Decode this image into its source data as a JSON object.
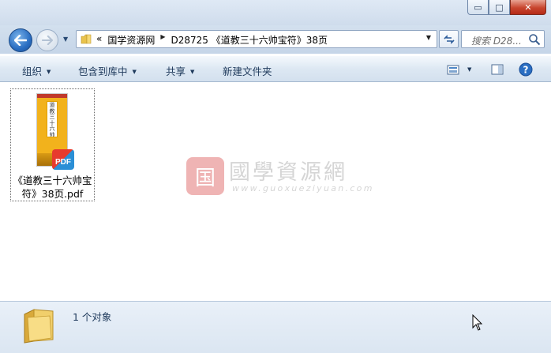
{
  "window": {
    "caption_buttons": {
      "minimize": "▭",
      "maximize": "□",
      "close": "✕"
    }
  },
  "nav": {
    "back_icon": "arrow-left-icon",
    "forward_icon": "arrow-right-icon",
    "breadcrumb": {
      "overflow": "«",
      "items": [
        "国学资源网",
        "D28725 《道教三十六帅宝符》38页"
      ],
      "separator": "▶"
    },
    "refresh_label": "↻",
    "search_placeholder": "搜索 D28..."
  },
  "toolbar": {
    "organize": "组织",
    "include_in_library": "包含到库中",
    "share": "共享",
    "new_folder": "新建文件夹"
  },
  "file": {
    "name_line1": "《道教三十六帅宝",
    "name_line2": "符》38页.pdf",
    "badge": "PDF",
    "thumb_title": "道教三十六帅宝符"
  },
  "watermark": {
    "chinese": "國學資源網",
    "url": "www.guoxueziyuan.com",
    "seal": "国"
  },
  "details": {
    "count_text": "1 个对象"
  },
  "colors": {
    "accent": "#2a6ec2",
    "pdf_thumb": "#f2b21c",
    "close_button": "#c8452e"
  }
}
